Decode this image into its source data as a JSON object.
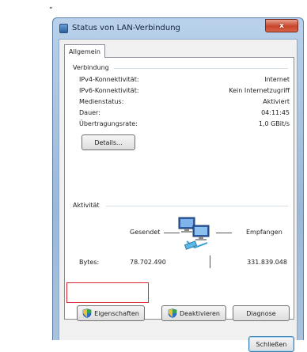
{
  "quote_mark": "„",
  "window": {
    "title": "Status von LAN-Verbindung",
    "close_glyph": "x",
    "title_icon": "network-adapter-icon"
  },
  "tabs": [
    {
      "label": "Allgemein"
    }
  ],
  "connection": {
    "group_label": "Verbindung",
    "rows": [
      {
        "label": "IPv4-Konnektivität:",
        "value": "Internet"
      },
      {
        "label": "IPv6-Konnektivität:",
        "value": "Kein Internetzugriff"
      },
      {
        "label": "Medienstatus:",
        "value": "Aktiviert"
      },
      {
        "label": "Dauer:",
        "value": "04:11:45"
      },
      {
        "label": "Übertragungsrate:",
        "value": "1,0 GBit/s"
      }
    ],
    "details_button": "Details..."
  },
  "activity": {
    "group_label": "Aktivität",
    "sent_label": "Gesendet",
    "received_label": "Empfangen",
    "bytes_label": "Bytes:",
    "bytes_sent": "78.702.490",
    "bytes_received": "331.839.048",
    "icon": "network-computers-icon"
  },
  "buttons": {
    "properties": "Eigenschaften",
    "deactivate": "Deaktivieren",
    "diagnose": "Diagnose",
    "close": "Schließen"
  },
  "colors": {
    "highlight": "#d9262e",
    "titlebar": "#b9d1ea",
    "close_button": "#c8452a"
  }
}
